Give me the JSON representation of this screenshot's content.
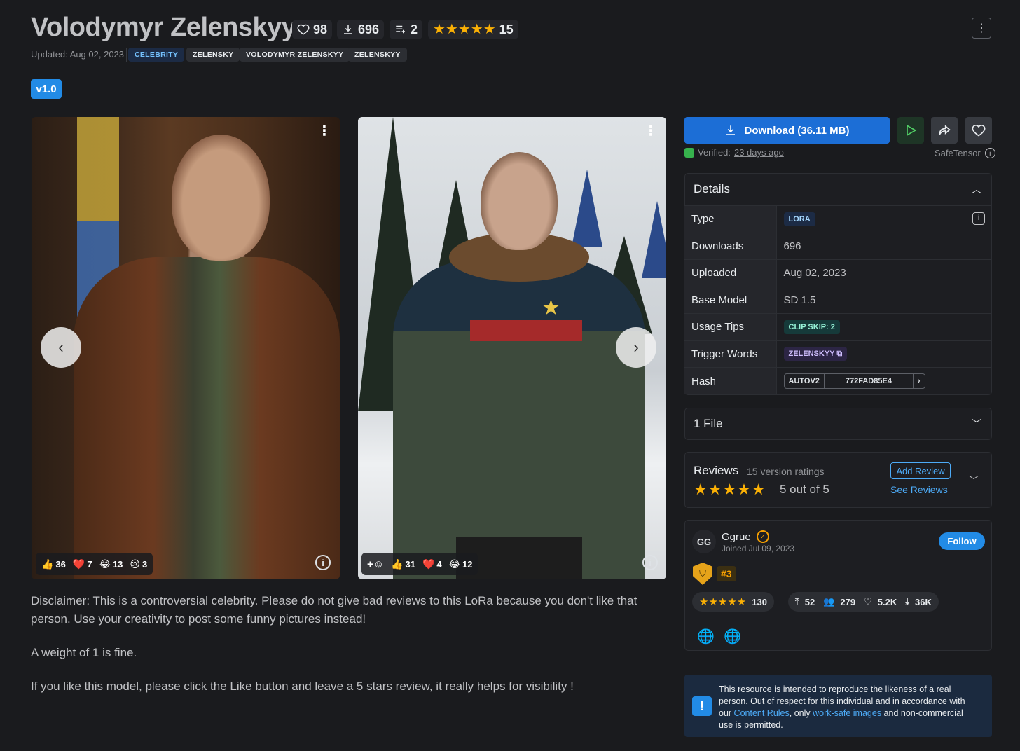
{
  "header": {
    "title": "Volodymyr Zelenskyy",
    "likes": "98",
    "downloads": "696",
    "collections": "2",
    "rating_count": "15",
    "updated": "Updated: Aug 02, 2023",
    "tags": [
      "CELEBRITY",
      "ZELENSKY",
      "VOLODYMYR ZELENSKYY",
      "ZELENSKYY"
    ],
    "menu_icon": "more-vertical-icon"
  },
  "version": "v1.0",
  "gallery": {
    "image1": {
      "reactions": {
        "like": "36",
        "heart": "7",
        "laugh": "13",
        "cry": "3"
      }
    },
    "image2": {
      "reactions": {
        "like": "31",
        "heart": "4",
        "laugh": "12"
      }
    },
    "prev_icon": "chevron-left-icon",
    "next_icon": "chevron-right-icon"
  },
  "description": {
    "p1": "Disclaimer: This is a controversial celebrity. Please do not give bad reviews to this LoRa because you don't like that person. Use your creativity to post some funny pictures instead!",
    "p2": "A weight of 1 is fine.",
    "p3": "If you like this model, please click the Like button and leave a 5 stars review, it really helps for visibility !"
  },
  "actions": {
    "download_label": "Download (36.11 MB)",
    "verified_prefix": "Verified:",
    "verified_when": "23 days ago",
    "safetensor": "SafeTensor"
  },
  "details": {
    "title": "Details",
    "rows": {
      "type": {
        "label": "Type",
        "value": "LORA"
      },
      "downloads": {
        "label": "Downloads",
        "value": "696"
      },
      "uploaded": {
        "label": "Uploaded",
        "value": "Aug 02, 2023"
      },
      "base_model": {
        "label": "Base Model",
        "value": "SD 1.5"
      },
      "usage_tips": {
        "label": "Usage Tips",
        "value": "CLIP SKIP: 2"
      },
      "trigger_words": {
        "label": "Trigger Words",
        "value": "ZELENSKYY"
      },
      "hash": {
        "label": "Hash",
        "algo": "AUTOV2",
        "value": "772FAD85E4"
      }
    }
  },
  "files": {
    "label": "1 File"
  },
  "reviews": {
    "title": "Reviews",
    "count_label": "15 version ratings",
    "score_label": "5 out of 5",
    "add_review": "Add Review",
    "see_reviews": "See Reviews"
  },
  "creator": {
    "initials": "GG",
    "name": "Ggrue",
    "joined": "Joined Jul 09, 2023",
    "follow": "Follow",
    "rank": "#3",
    "rating_count": "130",
    "uploads": "52",
    "followers": "279",
    "likes": "5.2K",
    "downloads": "36K"
  },
  "notice": {
    "t1": "This resource is intended to reproduce the likeness of a real person. Out of respect for this individual and in accordance with our ",
    "link1": "Content Rules",
    "t2": ", only ",
    "link2": "work-safe images",
    "t3": " and non-commercial use is permitted."
  },
  "colors": {
    "accent": "#228be6",
    "star": "#fab005",
    "bg": "#1a1b1e"
  }
}
